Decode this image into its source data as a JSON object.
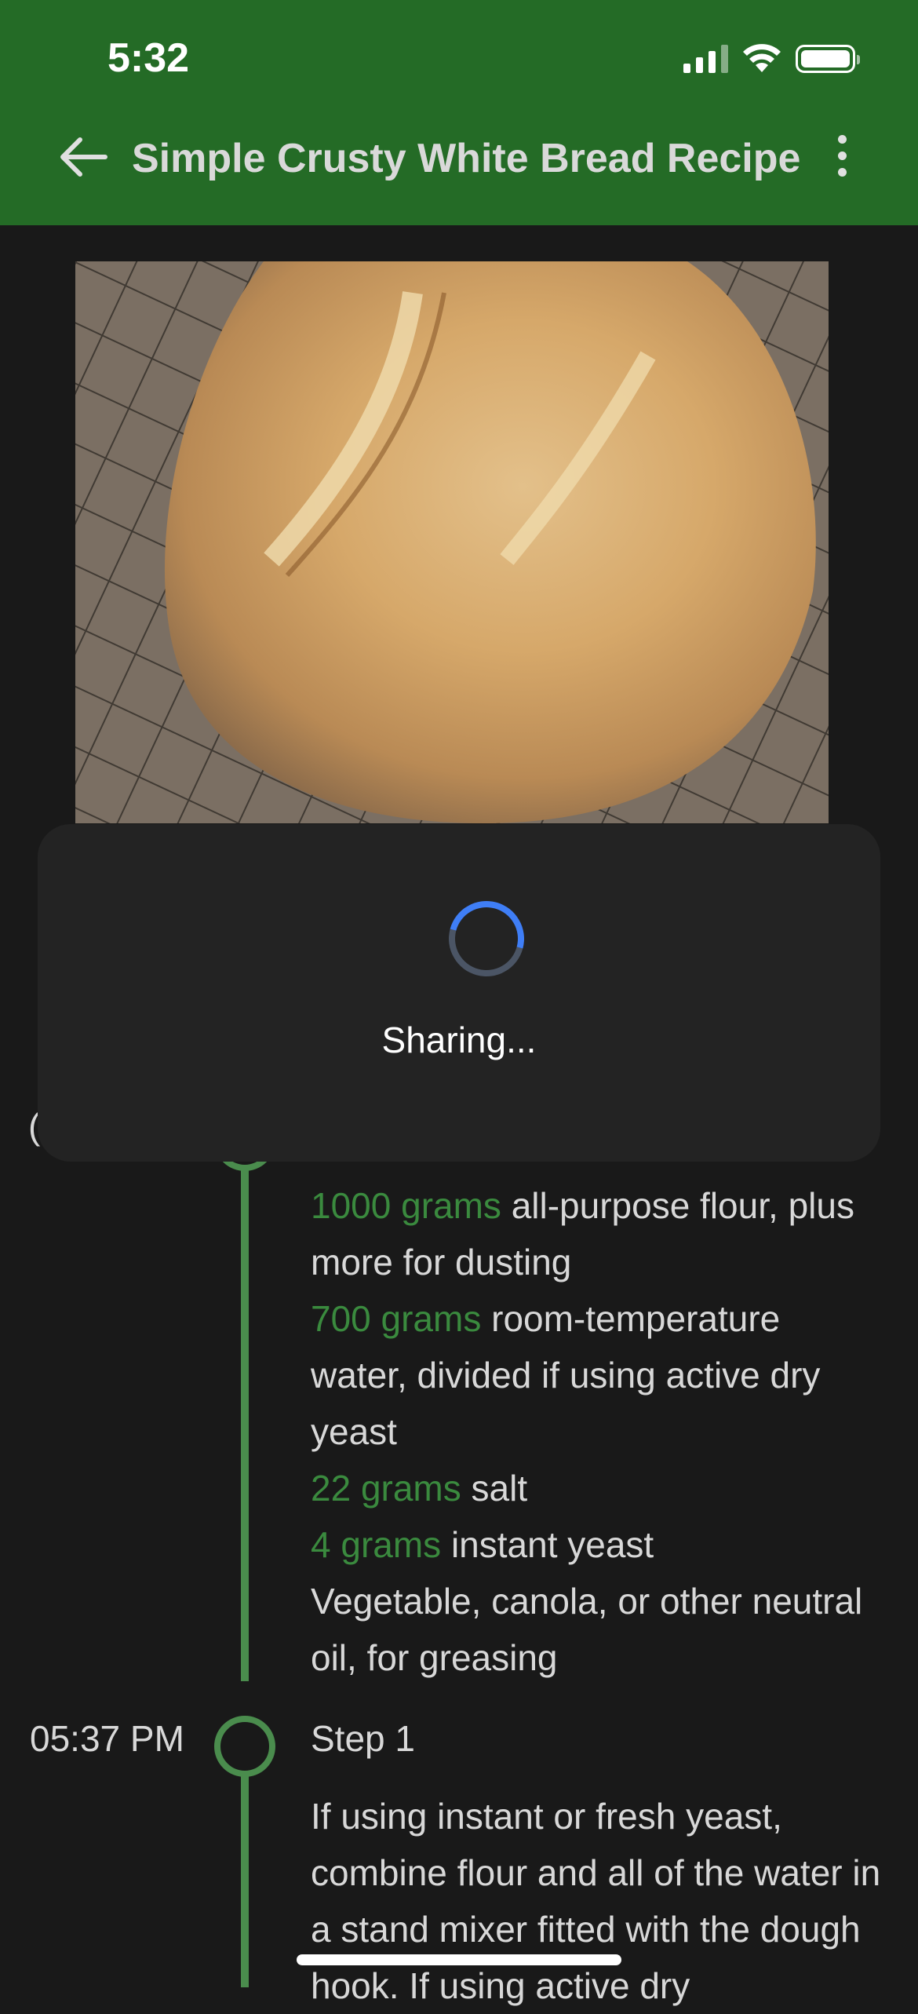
{
  "status_bar": {
    "time": "5:32"
  },
  "header": {
    "title": "Simple Crusty White Bread Recipe"
  },
  "dialog": {
    "message": "Sharing..."
  },
  "ingredients": [
    {
      "qty": "1000 grams",
      "text": "all-purpose flour, plus more for dusting"
    },
    {
      "qty": "700 grams",
      "text": "room-temperature water, divided if using active dry yeast"
    },
    {
      "qty": "22 grams",
      "text": "salt"
    },
    {
      "qty": "4 grams",
      "text": "instant yeast"
    },
    {
      "qty": "",
      "text": "Vegetable, canola, or other neutral oil, for greasing"
    }
  ],
  "step1": {
    "time": "05:37 PM",
    "title": "Step 1",
    "body": "If using instant or fresh yeast, combine flour and all of the water in a stand mixer fitted with the dough hook. If using active dry"
  },
  "colors": {
    "header": "#246b26",
    "accent": "#4a8c4d",
    "quantity": "#3a8a3e",
    "background": "#191919"
  }
}
